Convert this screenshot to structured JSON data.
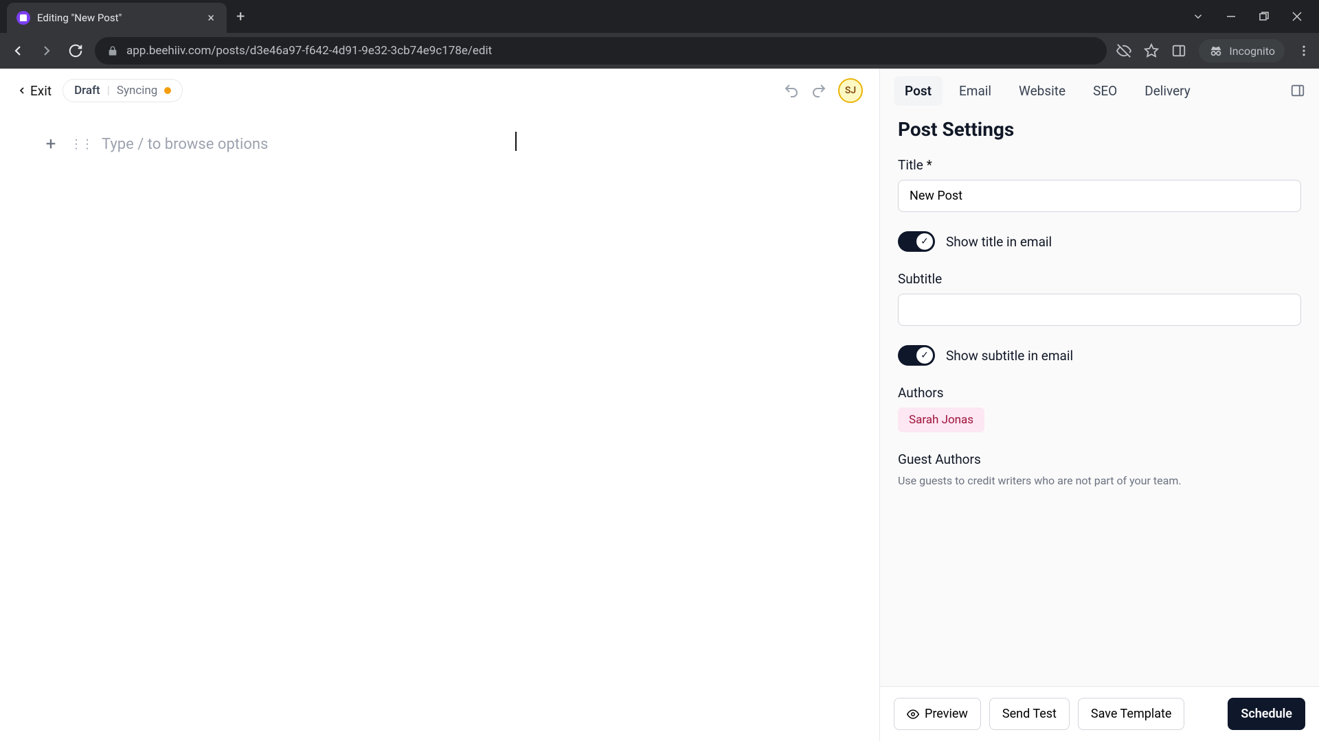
{
  "browser": {
    "tab_title": "Editing \"New Post\"",
    "url": "app.beehiiv.com/posts/d3e46a97-f642-4d91-9e32-3cb74e9c178e/edit",
    "incognito_label": "Incognito"
  },
  "header": {
    "exit_label": "Exit",
    "draft_label": "Draft",
    "sync_label": "Syncing",
    "user_initials": "SJ"
  },
  "editor": {
    "placeholder": "Type  /  to browse options"
  },
  "tabs": {
    "post": "Post",
    "email": "Email",
    "website": "Website",
    "seo": "SEO",
    "delivery": "Delivery"
  },
  "settings": {
    "heading": "Post Settings",
    "title_label": "Title",
    "title_value": "New Post",
    "show_title_label": "Show title in email",
    "subtitle_label": "Subtitle",
    "subtitle_value": "",
    "show_subtitle_label": "Show subtitle in email",
    "authors_label": "Authors",
    "author_name": "Sarah Jonas",
    "guest_authors_label": "Guest Authors",
    "guest_authors_help": "Use guests to credit writers who are not part of your team."
  },
  "footer": {
    "preview": "Preview",
    "send_test": "Send Test",
    "save_template": "Save Template",
    "schedule": "Schedule"
  }
}
